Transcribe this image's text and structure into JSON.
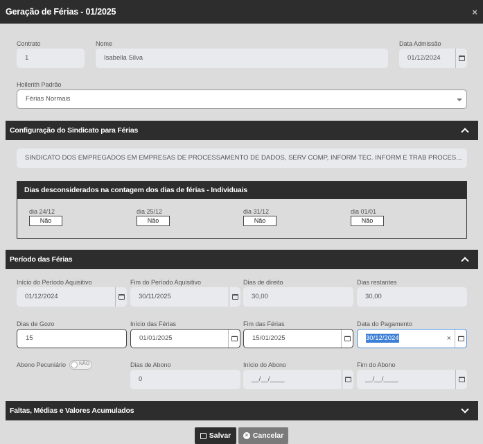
{
  "window": {
    "title": "Geração de Férias - 01/2025",
    "close": "×"
  },
  "contrato": {
    "label": "Contrato",
    "value": "1"
  },
  "nome": {
    "label": "Nome",
    "value": "Isabella Silva"
  },
  "data_admissao": {
    "label": "Data Admissão",
    "value": "01/12/2024"
  },
  "hollerith": {
    "label": "Hollerith Padrão",
    "value": "Férias Normais"
  },
  "sindicato": {
    "title": "Configuração do Sindicato para Férias",
    "name": "SINDICATO DOS EMPREGADOS EM EMPRESAS DE PROCESSAMENTO DE DADOS, SERV COMP, INFORM TEC. INFORM E TRAB PROCES...",
    "dias_title": "Dias desconsiderados na contagem dos dias de férias - Individuais",
    "dias": [
      {
        "label": "dia 24/12",
        "value": "Não"
      },
      {
        "label": "dia 25/12",
        "value": "Não"
      },
      {
        "label": "dia 31/12",
        "value": "Não"
      },
      {
        "label": "dia 01/01",
        "value": "Não"
      }
    ]
  },
  "periodo": {
    "title": "Período das Férias",
    "inicio_aquisitivo": {
      "label": "Início do Período Aquisitivo",
      "value": "01/12/2024"
    },
    "fim_aquisitivo": {
      "label": "Fim do Período Aquisitivo",
      "value": "30/11/2025"
    },
    "dias_direito": {
      "label": "Dias de direito",
      "value": "30,00"
    },
    "dias_restantes": {
      "label": "Dias restantes",
      "value": "30,00"
    },
    "dias_gozo": {
      "label": "Dias de Gozo",
      "value": "15"
    },
    "inicio_ferias": {
      "label": "Início das Férias",
      "value": "01/01/2025"
    },
    "fim_ferias": {
      "label": "Fim das Férias",
      "value": "15/01/2025"
    },
    "data_pagamento": {
      "label": "Data do Pagamento",
      "value": "30/12/2024",
      "clear": "×"
    },
    "abono": {
      "label": "Abono Pecuniário",
      "toggle": "NÃO"
    },
    "dias_abono": {
      "label": "Dias de Abono",
      "value": "0"
    },
    "inicio_abono": {
      "label": "Início do Abono",
      "value": "__/__/____"
    },
    "fim_abono": {
      "label": "Fim do Abono",
      "value": "__/__/____"
    }
  },
  "faltas": {
    "title": "Faltas, Médias e Valores Acumulados"
  },
  "buttons": {
    "save": "Salvar",
    "cancel": "Cancelar"
  },
  "colors": {
    "dark": "#2d2d2d",
    "input": "#e8eaed",
    "cancel": "#7a7a7a",
    "focus": "#4a90d9"
  }
}
